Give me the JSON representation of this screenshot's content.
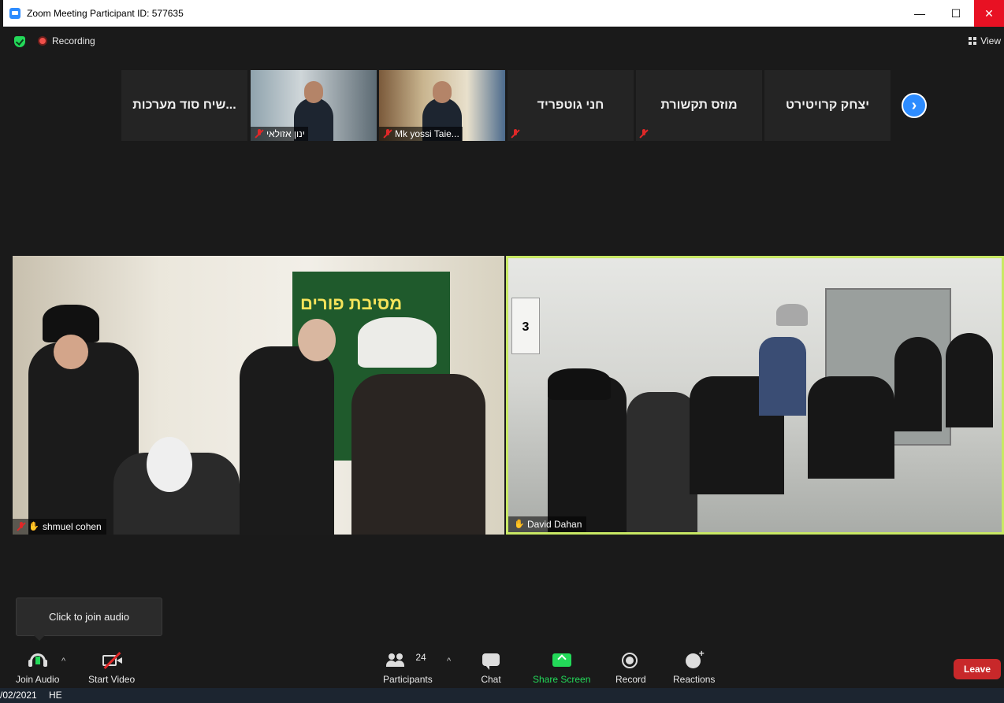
{
  "window": {
    "title": "Zoom Meeting Participant ID: 577635",
    "minimize_glyph": "—",
    "maximize_glyph": "☐",
    "close_glyph": "✕"
  },
  "topbar": {
    "recording_label": "Recording",
    "view_label": "View"
  },
  "strip_tiles": [
    {
      "name": "שיח סוד מערכות..."
    },
    {
      "name": "ינון אזולאי"
    },
    {
      "name": "Mk yossi Taie..."
    },
    {
      "name": "חני גוטפריד"
    },
    {
      "name": "מוזס תקשורת"
    },
    {
      "name": "יצחק קרויטירט"
    }
  ],
  "next_glyph": "›",
  "main": {
    "left_name": "shmuel cohen",
    "left_banner": "מסיבת פורים",
    "right_name": "David Dahan",
    "right_sign": "3"
  },
  "tooltip": "Click to join audio",
  "toolbar": {
    "join_audio": "Join Audio",
    "start_video": "Start Video",
    "participants": "Participants",
    "participants_count": "24",
    "chat": "Chat",
    "share_screen": "Share Screen",
    "record": "Record",
    "reactions": "Reactions",
    "leave": "Leave",
    "caret": "^"
  },
  "taskbar": {
    "date": "/02/2021",
    "lang": "HE"
  },
  "colors": {
    "accent": "#2d8cff",
    "share": "#23d959",
    "leave": "#c8282a",
    "active_speaker": "#c8e864"
  }
}
